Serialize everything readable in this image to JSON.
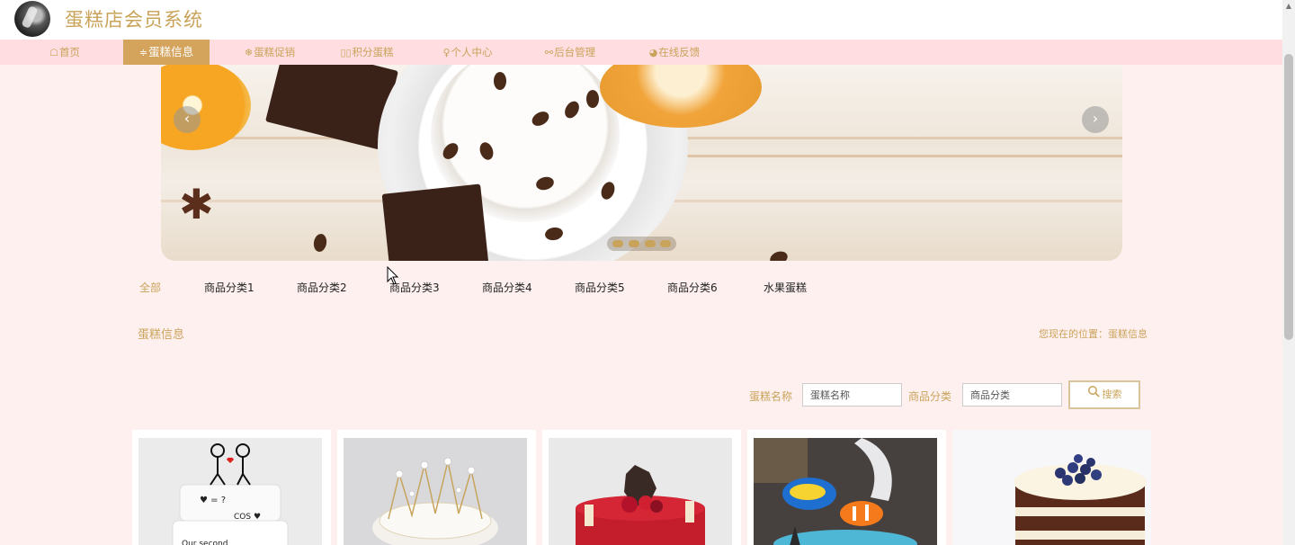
{
  "app": {
    "title": "蛋糕店会员系统",
    "logo_icon": "avatar-logo-icon"
  },
  "nav": {
    "items": [
      {
        "icon": "☖",
        "label": "首页",
        "active": false
      },
      {
        "icon": "≑",
        "label": "蛋糕信息",
        "active": true
      },
      {
        "icon": "❄",
        "label": "蛋糕促销",
        "active": false
      },
      {
        "icon": "▯▯",
        "label": "积分蛋糕",
        "active": false
      },
      {
        "icon": "♀",
        "label": "个人中心",
        "active": false
      },
      {
        "icon": "⚯",
        "label": "后台管理",
        "active": false
      },
      {
        "icon": "◕",
        "label": "在线反馈",
        "active": false
      }
    ]
  },
  "carousel": {
    "prev": "‹",
    "next": "›",
    "slides": 4,
    "active_slide": 1
  },
  "categories": [
    "全部",
    "商品分类1",
    "商品分类2",
    "商品分类3",
    "商品分类4",
    "商品分类5",
    "商品分类6",
    "水果蛋糕"
  ],
  "section": {
    "title": "蛋糕信息",
    "breadcrumb": "您现在的位置：蛋糕信息"
  },
  "search": {
    "name_label": "蛋糕名称",
    "name_placeholder": "蛋糕名称",
    "category_label": "商品分类",
    "category_placeholder": "商品分类",
    "button_icon": "search-icon",
    "button_label": "搜索"
  },
  "products": [
    {
      "image": "stick-figure-cake"
    },
    {
      "image": "pearl-crown-cake"
    },
    {
      "image": "berry-mousse-cake"
    },
    {
      "image": "ocean-fish-cake"
    },
    {
      "image": "blueberry-naked-cake"
    }
  ],
  "colors": {
    "accent": "#c9a35a",
    "nav_bg": "#ffdde0",
    "page_bg": "#fff0f0",
    "active_tab": "#d4a35c"
  }
}
